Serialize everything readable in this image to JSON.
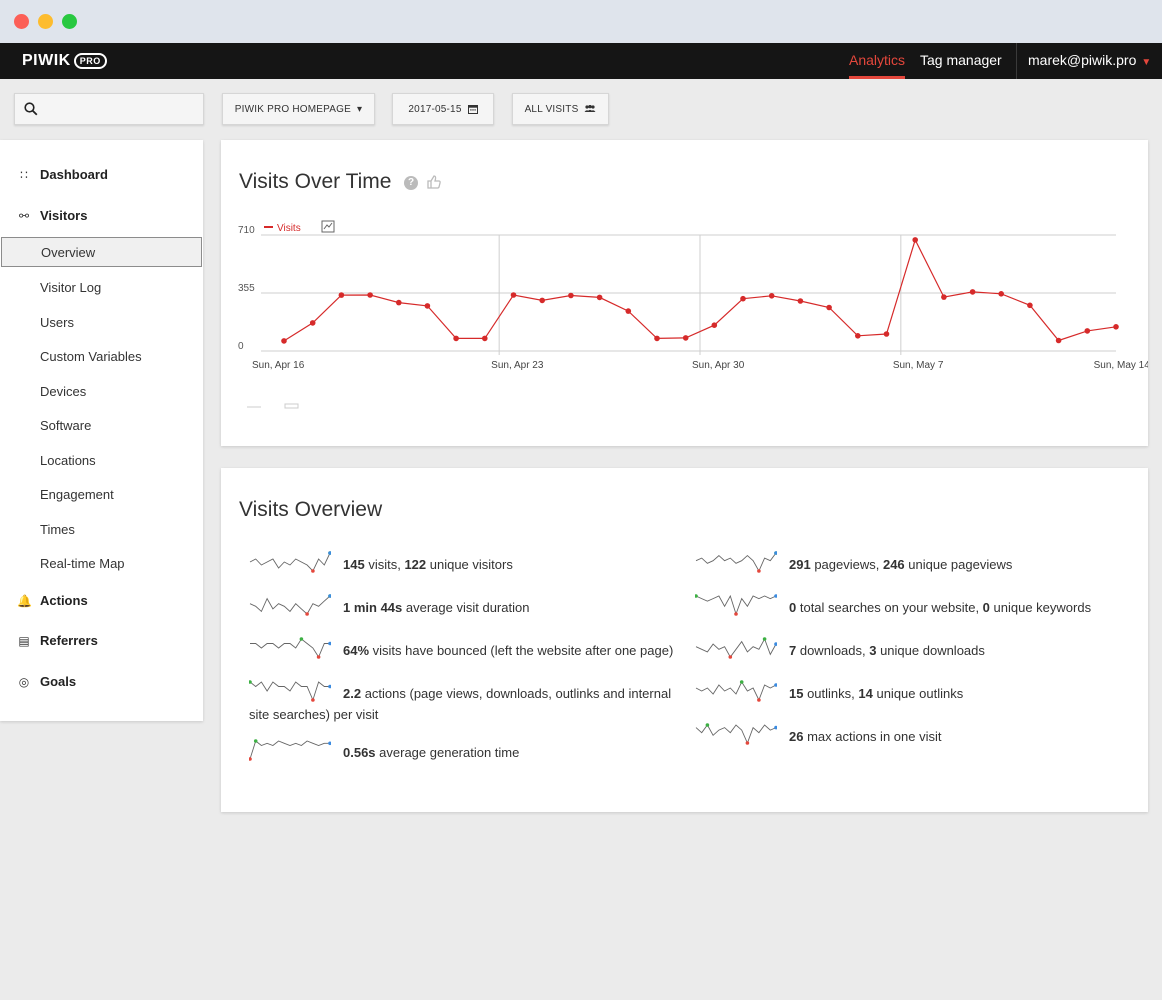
{
  "window": {
    "controls": [
      "close",
      "minimize",
      "maximize"
    ]
  },
  "topnav": {
    "logo_text": "PIWIK",
    "logo_badge": "PRO",
    "links": {
      "analytics": "Analytics",
      "tag_manager": "Tag manager"
    },
    "user": "marek@piwik.pro",
    "accent_color": "#e4473c"
  },
  "toolbar": {
    "search_icon": "search-icon",
    "site_selector": "PIWIK PRO HOMEPAGE",
    "site_caret": "▾",
    "date": "2017-05-15",
    "segment": "ALL VISITS"
  },
  "sidebar": {
    "sections": [
      {
        "label": "Dashboard",
        "icon": "grid-icon"
      },
      {
        "label": "Visitors",
        "icon": "binoculars-icon"
      },
      {
        "label": "Actions",
        "icon": "bell-icon"
      },
      {
        "label": "Referrers",
        "icon": "window-icon"
      },
      {
        "label": "Goals",
        "icon": "target-icon"
      }
    ],
    "visitor_items": [
      "Overview",
      "Visitor Log",
      "Users",
      "Custom Variables",
      "Devices",
      "Software",
      "Locations",
      "Engagement",
      "Times",
      "Real-time Map"
    ],
    "active_item": "Overview"
  },
  "evolution": {
    "title": "Visits Over Time",
    "help": "?"
  },
  "chart_data": {
    "type": "line",
    "title": "Visits Over Time",
    "series": [
      {
        "name": "Visits",
        "color": "#d62a2a",
        "values": [
          62,
          172,
          342,
          343,
          296,
          276,
          77,
          77,
          343,
          310,
          340,
          328,
          244,
          77,
          80,
          158,
          320,
          338,
          306,
          266,
          93,
          104,
          680,
          330,
          362,
          350,
          280,
          64,
          123,
          148
        ]
      }
    ],
    "x_tick_labels": [
      "Sun, Apr 16",
      "Sun, Apr 23",
      "Sun, Apr 30",
      "Sun, May 7",
      "Sun, May 14"
    ],
    "x_tick_index": [
      1,
      8,
      15,
      22,
      29
    ],
    "y_tick_labels": [
      "0",
      "355",
      "710"
    ],
    "ylim": [
      0,
      710
    ],
    "grid": true
  },
  "overview": {
    "title": "Visits Overview",
    "left": [
      {
        "strong1": "145",
        "t1": " visits, ",
        "strong2": "122",
        "t2": " unique visitors"
      },
      {
        "strong1": "1 min 44s",
        "t1": " average visit duration",
        "strong2": "",
        "t2": ""
      },
      {
        "strong1": "64%",
        "t1": " visits have bounced (left the website after one page)",
        "strong2": "",
        "t2": ""
      },
      {
        "strong1": "2.2",
        "t1": " actions (page views, downloads, outlinks and internal",
        "strong2": "",
        "t2": ""
      },
      {
        "strong1": "0.56s",
        "t1": " average generation time",
        "strong2": "",
        "t2": ""
      }
    ],
    "left_wrap": "site searches) per visit",
    "right": [
      {
        "strong1": "291",
        "t1": " pageviews, ",
        "strong2": "246",
        "t2": " unique pageviews"
      },
      {
        "strong1": "0",
        "t1": " total searches on your website, ",
        "strong2": "0",
        "t2": " unique keywords"
      },
      {
        "strong1": "7",
        "t1": " downloads, ",
        "strong2": "3",
        "t2": " unique downloads"
      },
      {
        "strong1": "15",
        "t1": " outlinks, ",
        "strong2": "14",
        "t2": " unique outlinks"
      },
      {
        "strong1": "26",
        "t1": " max actions in one visit",
        "strong2": "",
        "t2": ""
      }
    ]
  }
}
